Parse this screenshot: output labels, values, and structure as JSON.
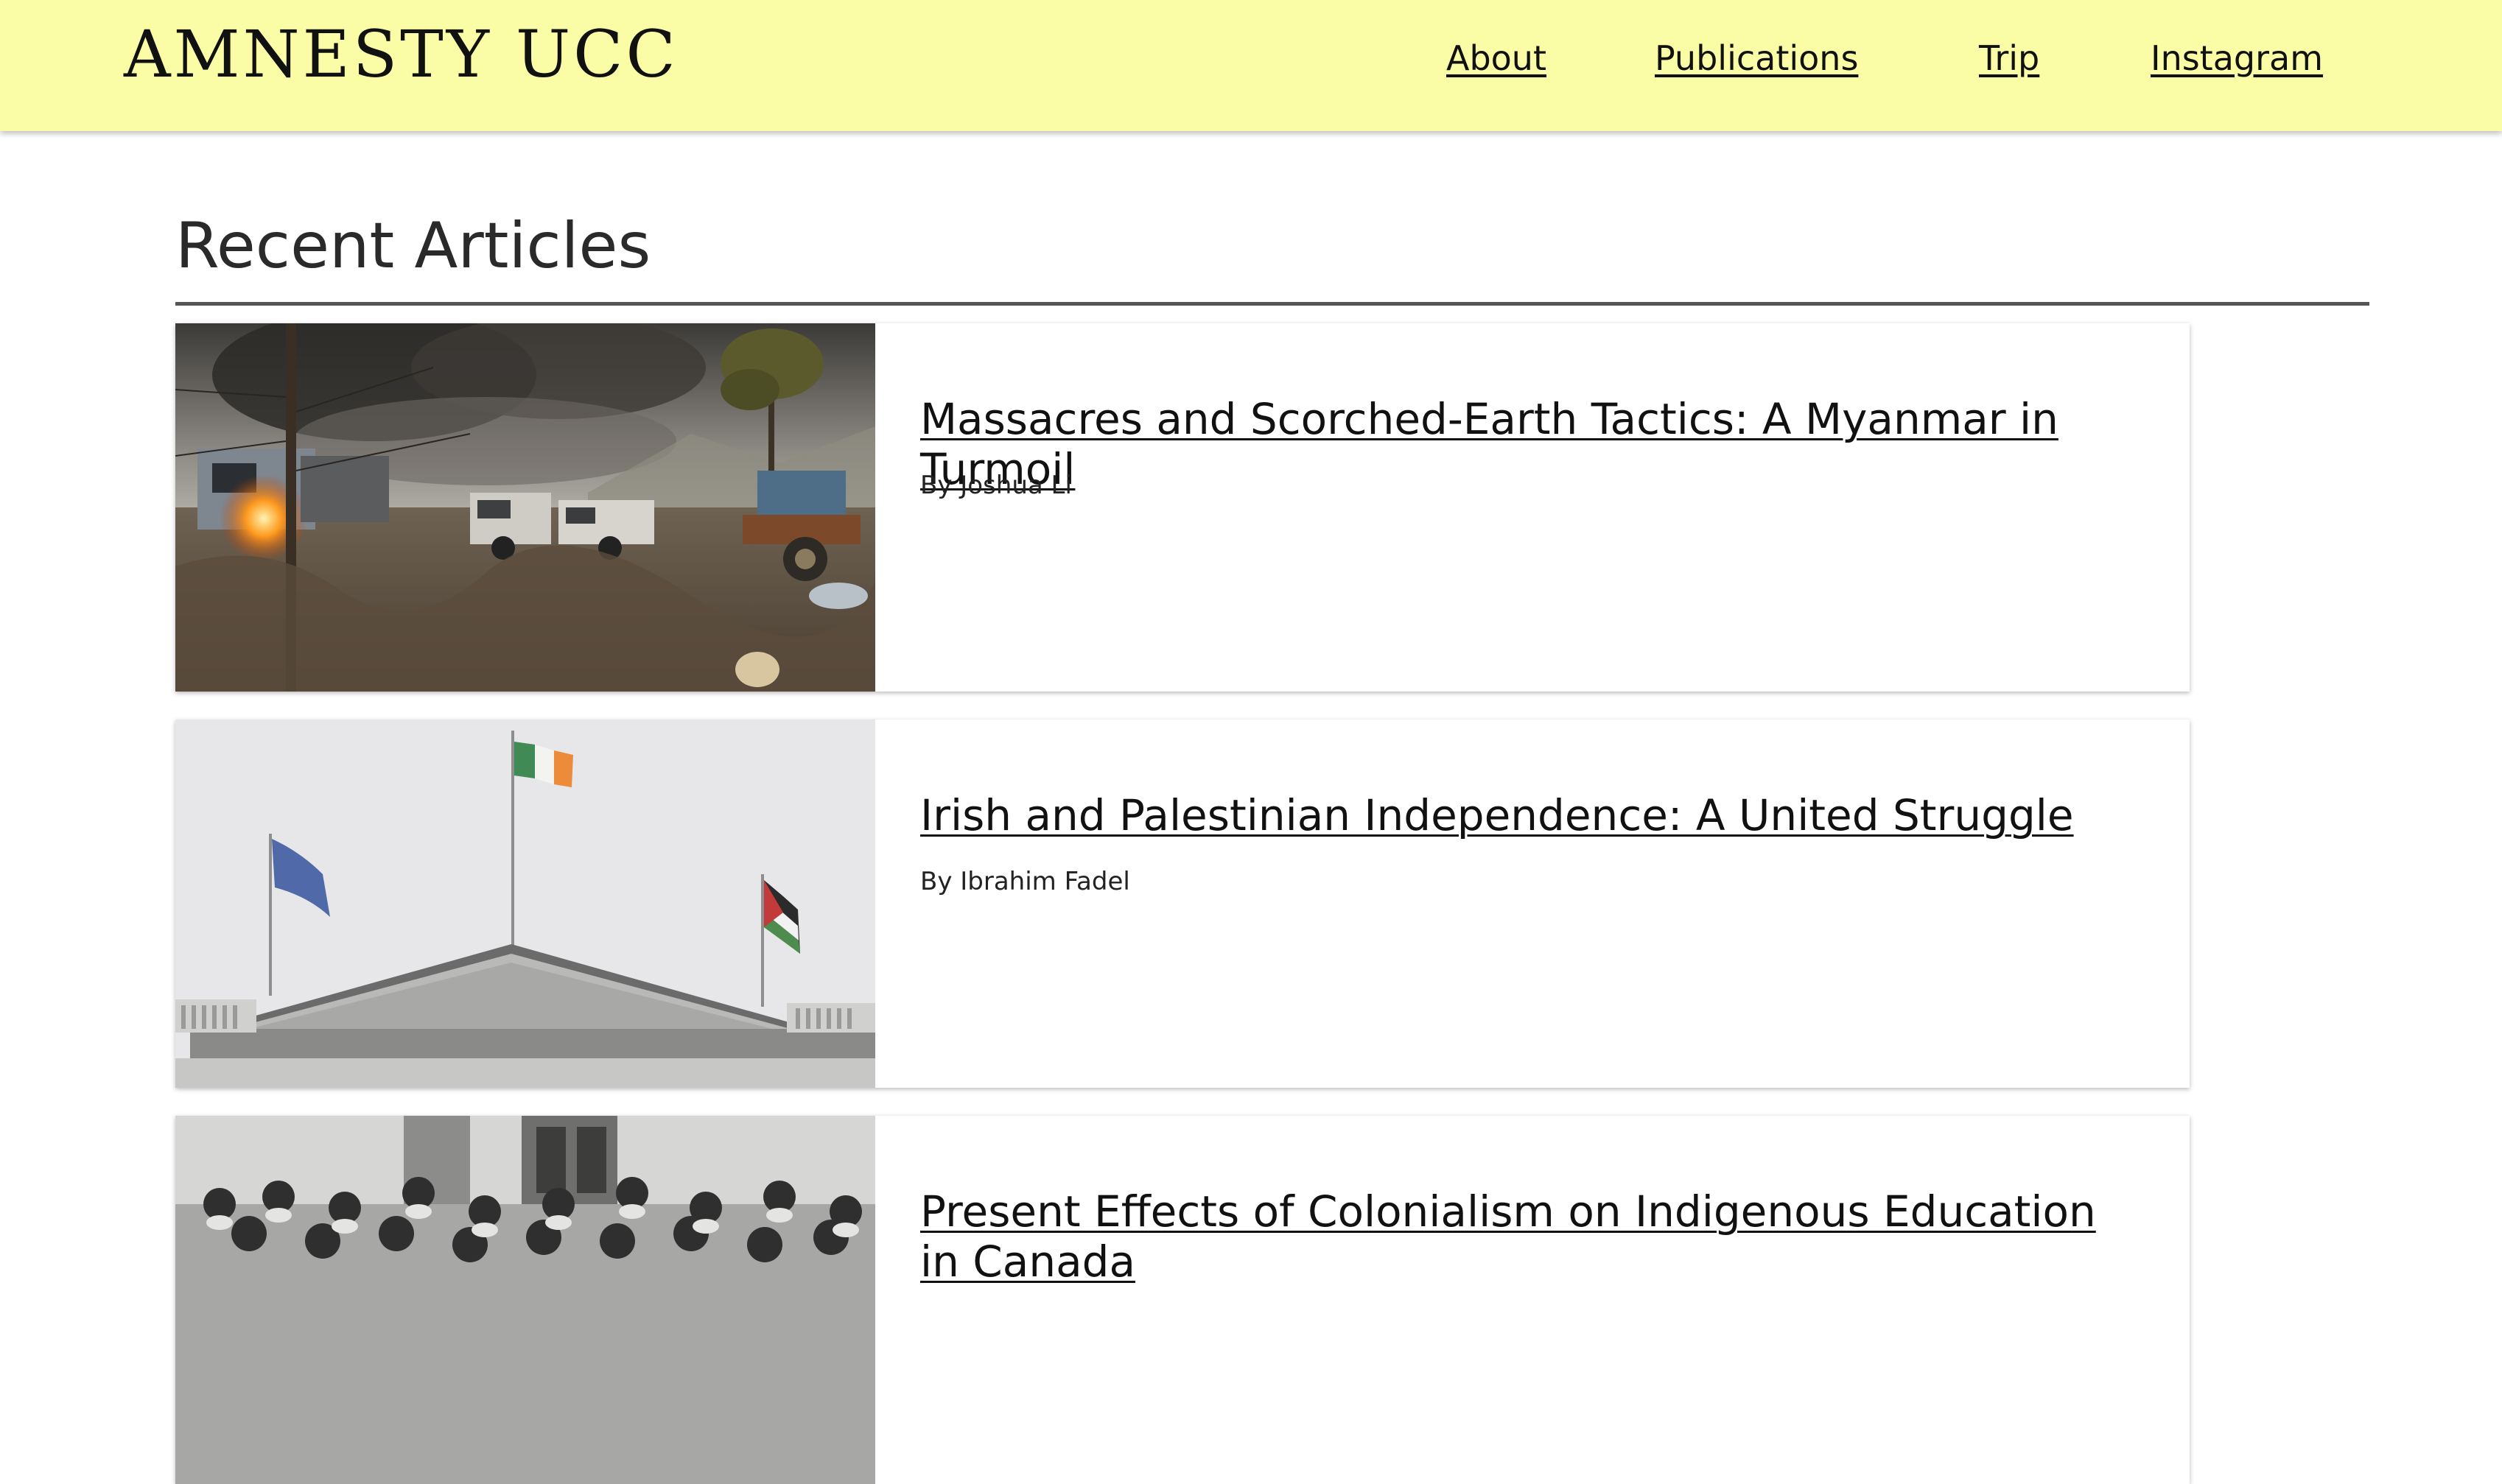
{
  "header": {
    "brand": "AMNESTY UCC",
    "nav": {
      "about": "About",
      "publications": "Publications",
      "trip": "Trip",
      "instagram": "Instagram"
    },
    "background_color": "#fbfda6"
  },
  "main": {
    "section_title": "Recent Articles",
    "articles": [
      {
        "title": "Massacres and Scorched-Earth Tactics: A Myanmar in Turmoil",
        "author": "By Joshua Li"
      },
      {
        "title": "Irish and Palestinian Independence: A United Struggle",
        "author": "By Ibrahim Fadel"
      },
      {
        "title": "Present Effects of Colonialism on Indigenous Education in Canada",
        "author": ""
      }
    ]
  }
}
